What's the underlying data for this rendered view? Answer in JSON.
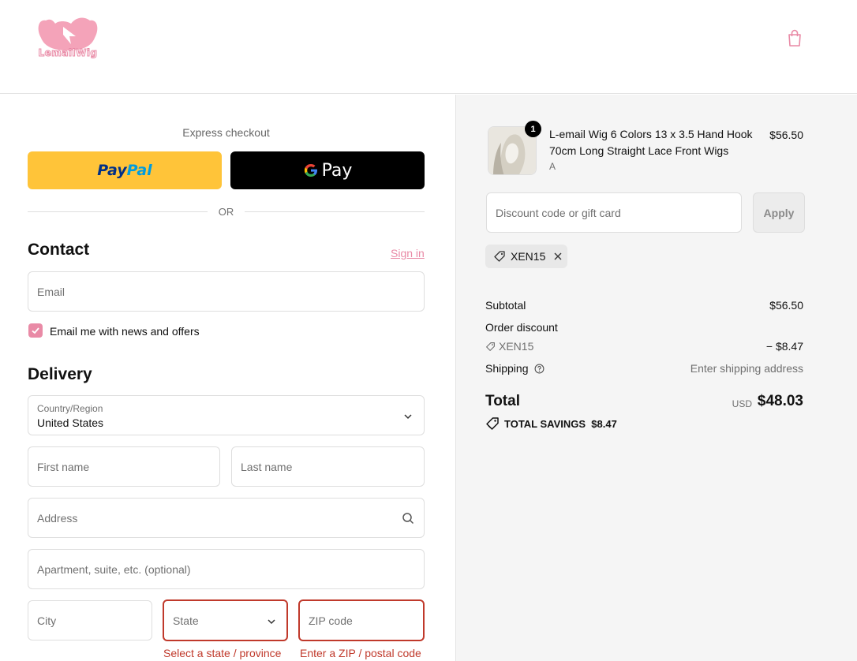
{
  "header": {
    "logo_text": "LemailWig",
    "cart_icon": "shopping-bag-icon"
  },
  "express": {
    "label": "Express checkout",
    "paypal_label_a": "Pay",
    "paypal_label_b": "Pal",
    "gpay_label": "Pay",
    "or_text": "OR"
  },
  "contact": {
    "title": "Contact",
    "signin": "Sign in",
    "email_placeholder": "Email",
    "newsletter_label": "Email me with news and offers",
    "newsletter_checked": true
  },
  "delivery": {
    "title": "Delivery",
    "country_label": "Country/Region",
    "country_value": "United States",
    "first_name": "First name",
    "last_name": "Last name",
    "address": "Address",
    "apartment": "Apartment, suite, etc. (optional)",
    "city": "City",
    "state": "State",
    "state_error": "Select a state / province",
    "zip": "ZIP code",
    "zip_error": "Enter a ZIP / postal code"
  },
  "order": {
    "item": {
      "title": "L-email Wig 6 Colors 13 x 3.5 Hand Hook 70cm Long Straight Lace Front Wigs",
      "variant": "A",
      "price": "$56.50",
      "quantity": "1"
    },
    "discount_placeholder": "Discount code or gift card",
    "apply_label": "Apply",
    "applied_code": "XEN15",
    "subtotal_label": "Subtotal",
    "subtotal_value": "$56.50",
    "order_discount_label": "Order discount",
    "discount_code": "XEN15",
    "discount_value": "− $8.47",
    "shipping_label": "Shipping",
    "shipping_value": "Enter shipping address",
    "total_label": "Total",
    "currency": "USD",
    "total_value": "$48.03",
    "savings_label": "TOTAL SAVINGS",
    "savings_value": "$8.47"
  },
  "colors": {
    "brand_pink": "#e98aa6",
    "error_red": "#c0392b",
    "paypal_yellow": "#ffc439"
  }
}
